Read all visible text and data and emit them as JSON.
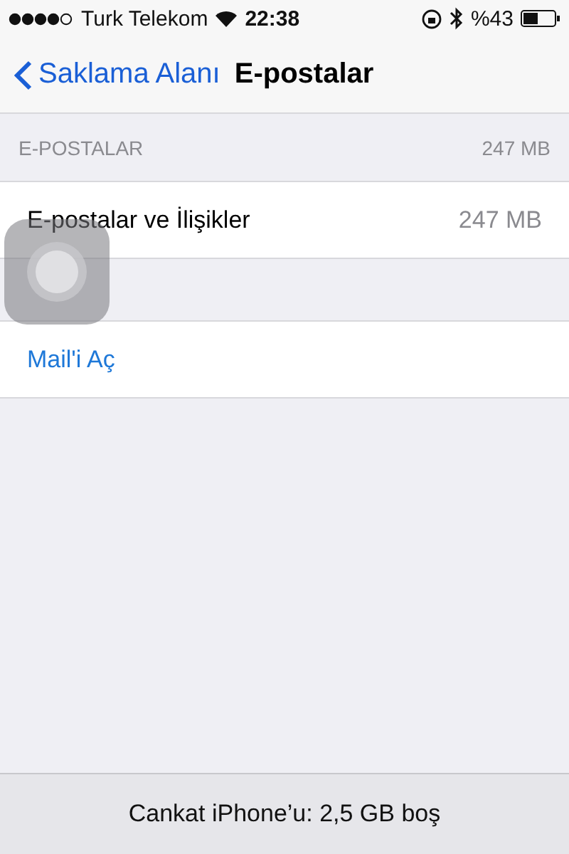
{
  "status_bar": {
    "carrier": "Turk Telekom",
    "time": "22:38",
    "battery": "%43"
  },
  "nav": {
    "back": "Saklama Alanı",
    "title": "E-postalar"
  },
  "section": {
    "title": "E-POSTALAR",
    "size": "247 MB"
  },
  "rows": [
    {
      "kind": "detail",
      "label": "E-postalar ve İlişikler",
      "value": "247 MB"
    },
    {
      "kind": "action",
      "label": "Mail'i Aç"
    }
  ],
  "footer": "Cankat iPhone’u: 2,5 GB boş"
}
